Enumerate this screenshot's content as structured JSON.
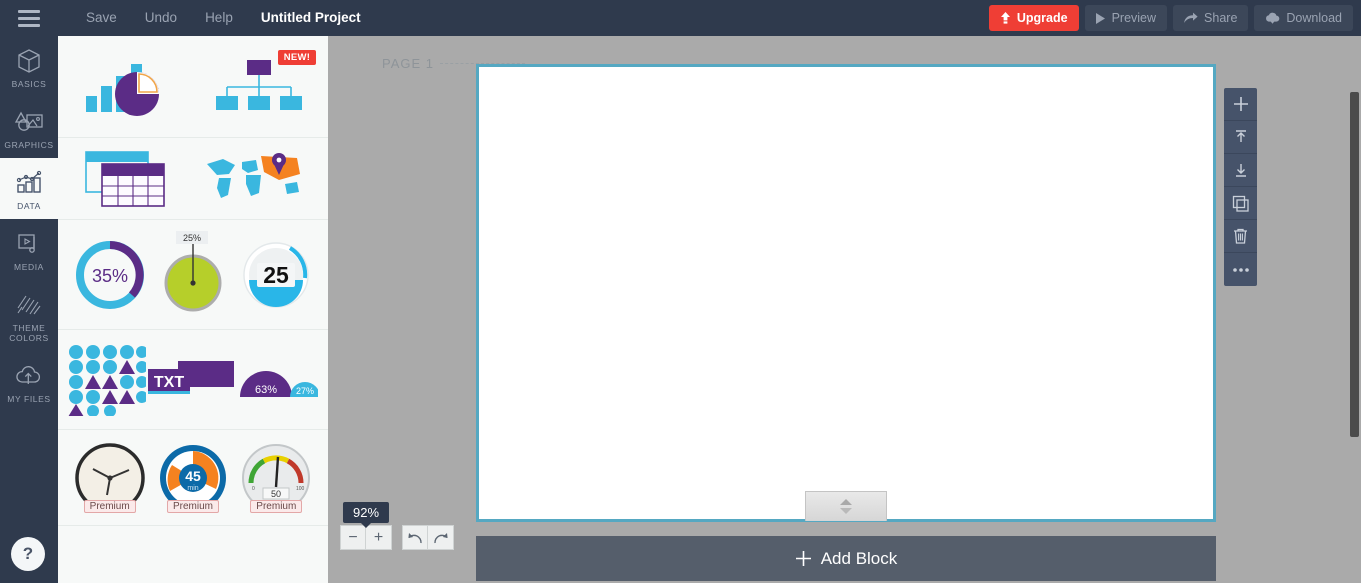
{
  "header": {
    "menu_icon": "hamburger-icon",
    "links": [
      {
        "label": "Save",
        "icon": "save"
      },
      {
        "label": "Undo",
        "icon": "undo"
      },
      {
        "label": "Help",
        "icon": "help"
      }
    ],
    "project_title": "Untitled Project",
    "actions": [
      {
        "label": "Upgrade",
        "icon": "upload-arrow-icon",
        "style": "primary",
        "color": "#ef3e35"
      },
      {
        "label": "Preview",
        "icon": "play-icon",
        "style": "dark"
      },
      {
        "label": "Share",
        "icon": "share-arrow-icon",
        "style": "dark"
      },
      {
        "label": "Download",
        "icon": "cloud-download-icon",
        "style": "dark"
      }
    ]
  },
  "sidebar": {
    "items": [
      {
        "label": "BASICS",
        "icon": "cube-icon",
        "active": false
      },
      {
        "label": "GRAPHICS",
        "icon": "image-shapes-icon",
        "active": false
      },
      {
        "label": "DATA",
        "icon": "chart-data-icon",
        "active": true
      },
      {
        "label": "MEDIA",
        "icon": "video-note-icon",
        "active": false
      },
      {
        "label": "THEME COLORS",
        "icon": "hatch-lines-icon",
        "active": false
      },
      {
        "label": "MY FILES",
        "icon": "cloud-upload-icon",
        "active": false
      }
    ],
    "help_label": "?"
  },
  "panel": {
    "rows": [
      {
        "items": [
          {
            "name": "bar-pie-chart-thumb",
            "badge": ""
          },
          {
            "name": "org-chart-thumb",
            "badge": "NEW!"
          }
        ]
      },
      {
        "items": [
          {
            "name": "table-thumb",
            "badge": ""
          },
          {
            "name": "world-map-thumb",
            "badge": ""
          }
        ]
      },
      {
        "items": [
          {
            "name": "donut-gauge-thumb",
            "value": "35%"
          },
          {
            "name": "dial-gauge-thumb",
            "value": "25%"
          },
          {
            "name": "number-gauge-thumb",
            "value": "25"
          }
        ]
      },
      {
        "items": [
          {
            "name": "pictogram-thumb",
            "value": ""
          },
          {
            "name": "text-label-thumb",
            "value": "TXT"
          },
          {
            "name": "semicircle-gauge-thumb",
            "value": "63%",
            "value2": "27%"
          }
        ]
      },
      {
        "items": [
          {
            "name": "analog-clock-thumb",
            "badge": "Premium",
            "value": ""
          },
          {
            "name": "minute-dial-thumb",
            "badge": "Premium",
            "value": "45",
            "sub": "min"
          },
          {
            "name": "speedometer-thumb",
            "badge": "Premium",
            "value": "50",
            "min": "0",
            "max": "100"
          }
        ]
      }
    ]
  },
  "workspace": {
    "page_label": "PAGE 1",
    "add_block_label": "Add Block",
    "add_block_icon": "plus-icon",
    "canvas_border_color": "#55a8c2",
    "object_toolbar": [
      {
        "name": "add-object-button",
        "icon": "plus-icon"
      },
      {
        "name": "move-up-button",
        "icon": "arrow-up-bar-icon"
      },
      {
        "name": "move-down-button",
        "icon": "arrow-down-bar-icon"
      },
      {
        "name": "duplicate-button",
        "icon": "copy-icon"
      },
      {
        "name": "delete-button",
        "icon": "trash-icon"
      },
      {
        "name": "more-options-button",
        "icon": "ellipsis-icon"
      }
    ]
  },
  "zoom_controls": {
    "level": "92%",
    "minus_label": "−",
    "plus_label": "+",
    "undo_icon": "undo-arrow-icon",
    "redo_icon": "redo-arrow-icon"
  },
  "colors": {
    "chrome": "#2f3a4d",
    "accent_red": "#ef3e35",
    "cyan": "#3ab7df",
    "purple": "#5b2c86",
    "workspace_gray": "#aaaaaa"
  }
}
